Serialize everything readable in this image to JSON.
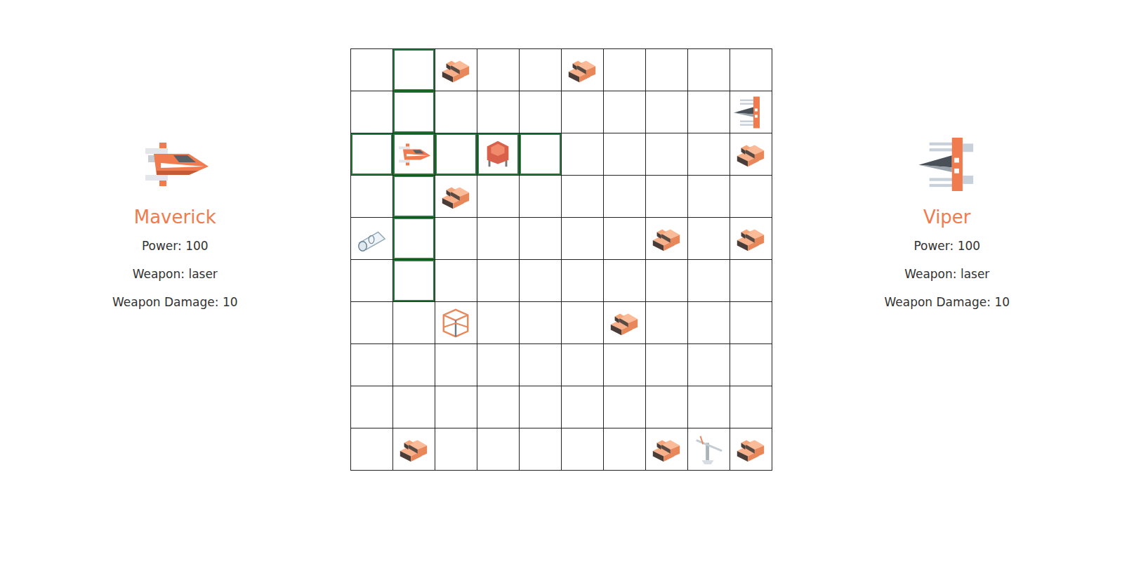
{
  "players": [
    {
      "name": "Maverick",
      "power": "Power: 100",
      "weapon": "Weapon: laser",
      "damage": "Weapon Damage: 10",
      "ship": "player"
    },
    {
      "name": "Viper",
      "power": "Power: 100",
      "weapon": "Weapon: laser",
      "damage": "Weapon Damage: 10",
      "ship": "enemy"
    }
  ],
  "board": {
    "rows": [
      [
        {
          "kind": "empty",
          "highlighted": false
        },
        {
          "kind": "empty",
          "highlighted": true
        },
        {
          "kind": "rock",
          "highlighted": false
        },
        {
          "kind": "empty",
          "highlighted": false
        },
        {
          "kind": "empty",
          "highlighted": false
        },
        {
          "kind": "rock",
          "highlighted": false
        },
        {
          "kind": "empty",
          "highlighted": false
        },
        {
          "kind": "empty",
          "highlighted": false
        },
        {
          "kind": "empty",
          "highlighted": false
        },
        {
          "kind": "empty",
          "highlighted": false
        }
      ],
      [
        {
          "kind": "empty",
          "highlighted": false
        },
        {
          "kind": "empty",
          "highlighted": true
        },
        {
          "kind": "empty",
          "highlighted": false
        },
        {
          "kind": "empty",
          "highlighted": false
        },
        {
          "kind": "empty",
          "highlighted": false
        },
        {
          "kind": "empty",
          "highlighted": false
        },
        {
          "kind": "empty",
          "highlighted": false
        },
        {
          "kind": "empty",
          "highlighted": false
        },
        {
          "kind": "empty",
          "highlighted": false
        },
        {
          "kind": "enemy",
          "highlighted": false
        }
      ],
      [
        {
          "kind": "empty",
          "highlighted": true
        },
        {
          "kind": "player",
          "highlighted": true
        },
        {
          "kind": "empty",
          "highlighted": true
        },
        {
          "kind": "shield",
          "highlighted": true
        },
        {
          "kind": "empty",
          "highlighted": true
        },
        {
          "kind": "empty",
          "highlighted": false
        },
        {
          "kind": "empty",
          "highlighted": false
        },
        {
          "kind": "empty",
          "highlighted": false
        },
        {
          "kind": "empty",
          "highlighted": false
        },
        {
          "kind": "rock",
          "highlighted": false
        }
      ],
      [
        {
          "kind": "empty",
          "highlighted": false
        },
        {
          "kind": "empty",
          "highlighted": true
        },
        {
          "kind": "rock",
          "highlighted": false
        },
        {
          "kind": "empty",
          "highlighted": false
        },
        {
          "kind": "empty",
          "highlighted": false
        },
        {
          "kind": "empty",
          "highlighted": false
        },
        {
          "kind": "empty",
          "highlighted": false
        },
        {
          "kind": "empty",
          "highlighted": false
        },
        {
          "kind": "empty",
          "highlighted": false
        },
        {
          "kind": "empty",
          "highlighted": false
        }
      ],
      [
        {
          "kind": "tube",
          "highlighted": false
        },
        {
          "kind": "empty",
          "highlighted": true
        },
        {
          "kind": "empty",
          "highlighted": false
        },
        {
          "kind": "empty",
          "highlighted": false
        },
        {
          "kind": "empty",
          "highlighted": false
        },
        {
          "kind": "empty",
          "highlighted": false
        },
        {
          "kind": "empty",
          "highlighted": false
        },
        {
          "kind": "rock",
          "highlighted": false
        },
        {
          "kind": "empty",
          "highlighted": false
        },
        {
          "kind": "rock",
          "highlighted": false
        }
      ],
      [
        {
          "kind": "empty",
          "highlighted": false
        },
        {
          "kind": "empty",
          "highlighted": true
        },
        {
          "kind": "empty",
          "highlighted": false
        },
        {
          "kind": "empty",
          "highlighted": false
        },
        {
          "kind": "empty",
          "highlighted": false
        },
        {
          "kind": "empty",
          "highlighted": false
        },
        {
          "kind": "empty",
          "highlighted": false
        },
        {
          "kind": "empty",
          "highlighted": false
        },
        {
          "kind": "empty",
          "highlighted": false
        },
        {
          "kind": "empty",
          "highlighted": false
        }
      ],
      [
        {
          "kind": "empty",
          "highlighted": false
        },
        {
          "kind": "empty",
          "highlighted": false
        },
        {
          "kind": "cube",
          "highlighted": false
        },
        {
          "kind": "empty",
          "highlighted": false
        },
        {
          "kind": "empty",
          "highlighted": false
        },
        {
          "kind": "empty",
          "highlighted": false
        },
        {
          "kind": "rock",
          "highlighted": false
        },
        {
          "kind": "empty",
          "highlighted": false
        },
        {
          "kind": "empty",
          "highlighted": false
        },
        {
          "kind": "empty",
          "highlighted": false
        }
      ],
      [
        {
          "kind": "empty",
          "highlighted": false
        },
        {
          "kind": "empty",
          "highlighted": false
        },
        {
          "kind": "empty",
          "highlighted": false
        },
        {
          "kind": "empty",
          "highlighted": false
        },
        {
          "kind": "empty",
          "highlighted": false
        },
        {
          "kind": "empty",
          "highlighted": false
        },
        {
          "kind": "empty",
          "highlighted": false
        },
        {
          "kind": "empty",
          "highlighted": false
        },
        {
          "kind": "empty",
          "highlighted": false
        },
        {
          "kind": "empty",
          "highlighted": false
        }
      ],
      [
        {
          "kind": "empty",
          "highlighted": false
        },
        {
          "kind": "empty",
          "highlighted": false
        },
        {
          "kind": "empty",
          "highlighted": false
        },
        {
          "kind": "empty",
          "highlighted": false
        },
        {
          "kind": "empty",
          "highlighted": false
        },
        {
          "kind": "empty",
          "highlighted": false
        },
        {
          "kind": "empty",
          "highlighted": false
        },
        {
          "kind": "empty",
          "highlighted": false
        },
        {
          "kind": "empty",
          "highlighted": false
        },
        {
          "kind": "empty",
          "highlighted": false
        }
      ],
      [
        {
          "kind": "empty",
          "highlighted": false
        },
        {
          "kind": "rock",
          "highlighted": false
        },
        {
          "kind": "empty",
          "highlighted": false
        },
        {
          "kind": "empty",
          "highlighted": false
        },
        {
          "kind": "empty",
          "highlighted": false
        },
        {
          "kind": "empty",
          "highlighted": false
        },
        {
          "kind": "empty",
          "highlighted": false
        },
        {
          "kind": "rock",
          "highlighted": false
        },
        {
          "kind": "satellite",
          "highlighted": false
        },
        {
          "kind": "rock",
          "highlighted": false
        }
      ]
    ]
  }
}
